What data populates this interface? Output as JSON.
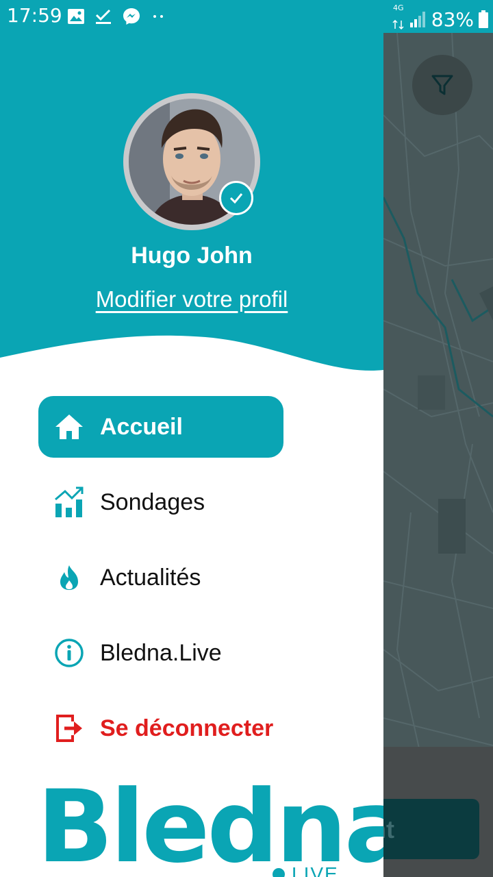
{
  "status_bar": {
    "time": "17:59",
    "network": "4G",
    "battery": "83%",
    "left_icons": [
      "image-icon",
      "check-icon",
      "messenger-icon",
      "more-dots-icon"
    ]
  },
  "profile": {
    "name": "Hugo John",
    "edit_link": "Modifier votre profil",
    "verified": true
  },
  "menu": {
    "items": [
      {
        "label": "Accueil",
        "icon": "home-icon",
        "active": true
      },
      {
        "label": "Sondages",
        "icon": "chart-icon",
        "active": false
      },
      {
        "label": "Actualités",
        "icon": "flame-icon",
        "active": false
      },
      {
        "label": "Bledna.Live",
        "icon": "info-icon",
        "active": false
      },
      {
        "label": "Se déconnecter",
        "icon": "logout-icon",
        "active": false
      }
    ]
  },
  "logo": {
    "text": "Bledna",
    "sub": "LIVE"
  },
  "map": {
    "cta_partial": "nt"
  },
  "colors": {
    "brand": "#0aa5b4",
    "danger": "#e01e1e",
    "overlay": "#3f4a4b"
  }
}
